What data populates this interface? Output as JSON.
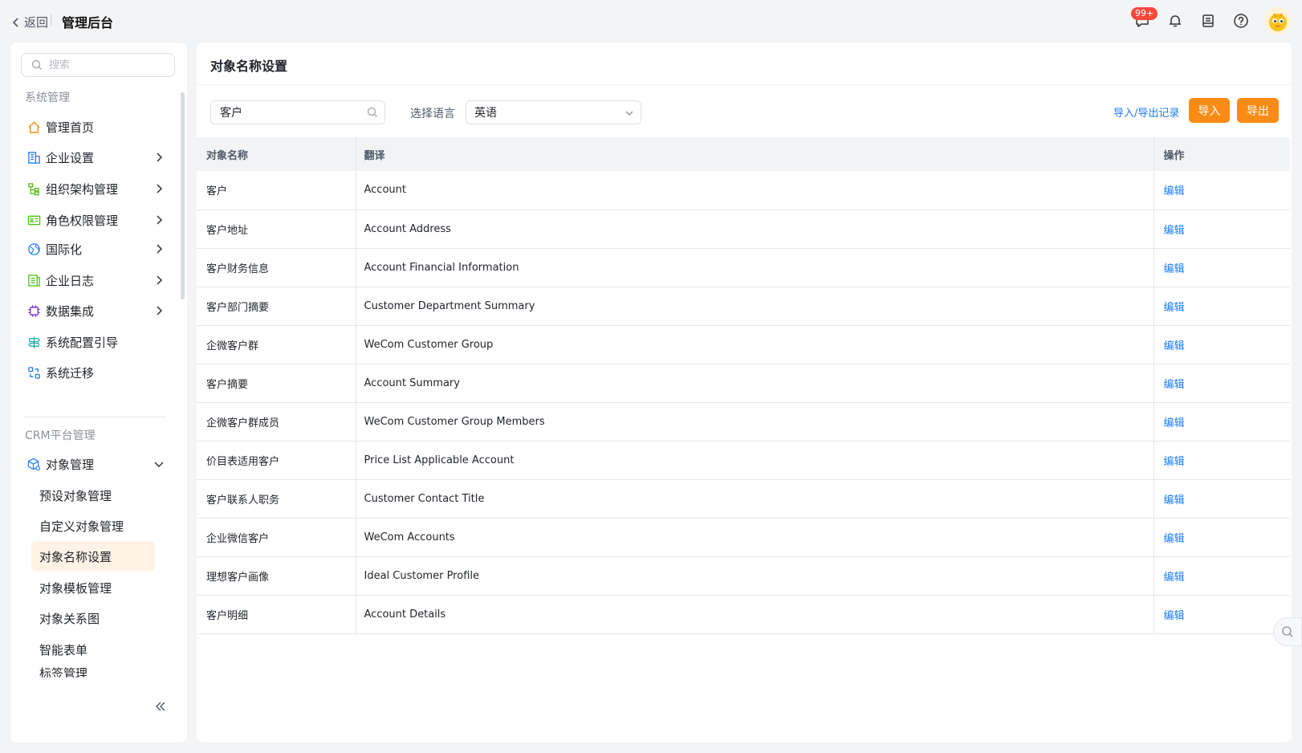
{
  "header": {
    "back_label": "返回",
    "app_title": "管理后台",
    "message_badge": "99+"
  },
  "sidebar": {
    "search_placeholder": "搜索",
    "group_system": "系统管理",
    "system_items": [
      {
        "label": "管理首页",
        "icon": "home-icon"
      },
      {
        "label": "企业设置",
        "icon": "building-icon"
      },
      {
        "label": "组织架构管理",
        "icon": "org-tree-icon"
      },
      {
        "label": "角色权限管理",
        "icon": "id-card-icon"
      },
      {
        "label": "国际化",
        "icon": "globe-icon"
      },
      {
        "label": "企业日志",
        "icon": "log-icon"
      },
      {
        "label": "数据集成",
        "icon": "chip-icon"
      },
      {
        "label": "系统配置引导",
        "icon": "signpost-icon"
      },
      {
        "label": "系统迁移",
        "icon": "migrate-icon"
      }
    ],
    "group_crm": "CRM平台管理",
    "object_mgmt": "对象管理",
    "sub_items": [
      {
        "label": "预设对象管理"
      },
      {
        "label": "自定义对象管理"
      },
      {
        "label": "对象名称设置"
      },
      {
        "label": "对象模板管理"
      },
      {
        "label": "对象关系图"
      },
      {
        "label": "智能表单"
      },
      {
        "label": "标签管理"
      }
    ]
  },
  "main": {
    "title": "对象名称设置",
    "search_value": "客户",
    "lang_label": "选择语言",
    "lang_value": "英语",
    "record_link": "导入/导出记录",
    "import_label": "导入",
    "export_label": "导出",
    "columns": [
      "对象名称",
      "翻译",
      "操作"
    ],
    "rows": [
      {
        "name": "客户",
        "translation": "Account",
        "action": "编辑"
      },
      {
        "name": "客户地址",
        "translation": "Account Address",
        "action": "编辑"
      },
      {
        "name": "客户财务信息",
        "translation": "Account Financial Information",
        "action": "编辑"
      },
      {
        "name": "客户部门摘要",
        "translation": "Customer Department Summary",
        "action": "编辑"
      },
      {
        "name": "企微客户群",
        "translation": "WeCom Customer Group",
        "action": "编辑"
      },
      {
        "name": "客户摘要",
        "translation": "Account Summary",
        "action": "编辑"
      },
      {
        "name": "企微客户群成员",
        "translation": "WeCom Customer Group Members",
        "action": "编辑"
      },
      {
        "name": "价目表适用客户",
        "translation": "Price List Applicable Account",
        "action": "编辑"
      },
      {
        "name": "客户联系人职务",
        "translation": "Customer Contact Title",
        "action": "编辑"
      },
      {
        "name": "企业微信客户",
        "translation": "WeCom Accounts",
        "action": "编辑"
      },
      {
        "name": "理想客户画像",
        "translation": "Ideal Customer Profile",
        "action": "编辑"
      },
      {
        "name": "客户明细",
        "translation": "Account Details",
        "action": "编辑"
      }
    ]
  },
  "colors": {
    "accent_orange": "#fa8c16",
    "link_blue": "#1e7cf5",
    "active_bg": "#fff3e6",
    "badge_red": "#f5483b"
  }
}
